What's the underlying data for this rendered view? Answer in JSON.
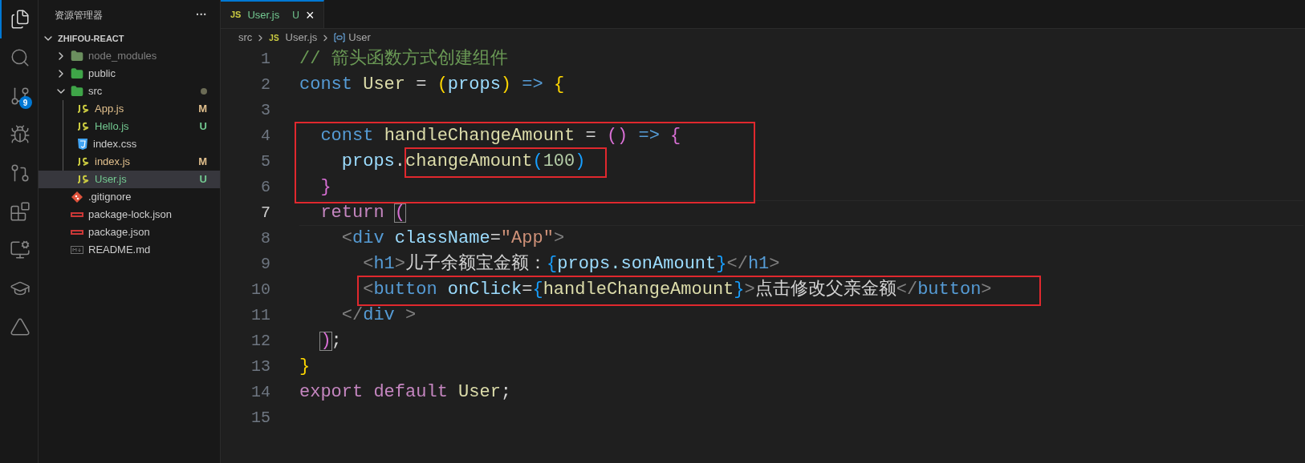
{
  "activity_bar": {
    "items": [
      {
        "kind": "explorer",
        "selected": true
      },
      {
        "kind": "search",
        "selected": false
      },
      {
        "kind": "source-control",
        "selected": false,
        "badge": "9"
      },
      {
        "kind": "run",
        "selected": false
      },
      {
        "kind": "git-graph",
        "selected": false
      },
      {
        "kind": "extensions",
        "selected": false
      },
      {
        "kind": "remote",
        "selected": false
      },
      {
        "kind": "learn",
        "selected": false
      },
      {
        "kind": "triangle",
        "selected": false
      }
    ]
  },
  "sidebar": {
    "title": "资源管理器",
    "more": "···",
    "project": {
      "name": "ZHIFOU-REACT",
      "expanded": true
    },
    "items": [
      {
        "name": "node_modules",
        "kind": "folder-node",
        "expanded": false,
        "dimmed": true,
        "selected": false
      },
      {
        "name": "public",
        "kind": "folder-public",
        "expanded": false,
        "dimmed": false,
        "selected": false
      },
      {
        "name": "src",
        "kind": "folder-src",
        "expanded": true,
        "dimmed": false,
        "selected": false,
        "dot": true,
        "children": [
          {
            "name": "App.js",
            "kind": "js",
            "status": "M",
            "color": "#e2c08d",
            "selected": false
          },
          {
            "name": "Hello.js",
            "kind": "js",
            "status": "U",
            "color": "#73c991",
            "selected": false
          },
          {
            "name": "index.css",
            "kind": "css",
            "selected": false
          },
          {
            "name": "index.js",
            "kind": "js",
            "status": "M",
            "color": "#e2c08d",
            "selected": false
          },
          {
            "name": "User.js",
            "kind": "js",
            "status": "U",
            "color": "#73c991",
            "selected": true
          }
        ]
      },
      {
        "name": ".gitignore",
        "kind": "git",
        "selected": false
      },
      {
        "name": "package-lock.json",
        "kind": "npm",
        "selected": false
      },
      {
        "name": "package.json",
        "kind": "npm",
        "selected": false
      },
      {
        "name": "README.md",
        "kind": "md",
        "selected": false
      }
    ]
  },
  "tabs": [
    {
      "icon_text": "JS",
      "label": "User.js",
      "status": "U",
      "close": "×",
      "selected": true
    }
  ],
  "breadcrumb": [
    {
      "kind": "folder",
      "text": "src"
    },
    {
      "kind": "file",
      "icon_text": "JS",
      "text": "User.js"
    },
    {
      "kind": "symbol",
      "text": "User"
    }
  ],
  "editor": {
    "lines": [
      {
        "number": "1",
        "current": false,
        "tokens": [
          {
            "text": "// 箭头函数方式创建组件",
            "kind": "comment"
          }
        ]
      },
      {
        "number": "2",
        "current": false,
        "tokens": [
          {
            "text": "const",
            "kind": "keyword"
          },
          {
            "text": " User",
            "kind": "function"
          },
          {
            "text": " = ",
            "kind": "plain"
          },
          {
            "text": "(",
            "kind": "bracket1"
          },
          {
            "text": "props",
            "kind": "variable"
          },
          {
            "text": ")",
            "kind": "bracket1"
          },
          {
            "text": " =>",
            "kind": "keyword"
          },
          {
            "text": " {",
            "kind": "bracket1"
          }
        ]
      },
      {
        "number": "3",
        "current": false
      },
      {
        "number": "4",
        "current": false,
        "tokens": [
          {
            "text": "  const",
            "kind": "keyword"
          },
          {
            "text": " handleChangeAmount",
            "kind": "function"
          },
          {
            "text": " = ",
            "kind": "plain"
          },
          {
            "text": "()",
            "kind": "bracket2"
          },
          {
            "text": " =>",
            "kind": "keyword"
          },
          {
            "text": " {",
            "kind": "bracket2"
          }
        ]
      },
      {
        "number": "5",
        "current": false,
        "tokens": [
          {
            "text": "    props",
            "kind": "variable"
          },
          {
            "text": ".",
            "kind": "plain"
          },
          {
            "text": "changeAmount",
            "kind": "function"
          },
          {
            "text": "(",
            "kind": "bracket3"
          },
          {
            "text": "100",
            "kind": "number"
          },
          {
            "text": ")",
            "kind": "bracket3"
          }
        ]
      },
      {
        "number": "6",
        "current": false,
        "tokens": [
          {
            "text": "  }",
            "kind": "bracket2"
          }
        ]
      },
      {
        "number": "7",
        "current": true,
        "tokens": [
          {
            "text": "  return",
            "kind": "control"
          },
          {
            "text": " (",
            "kind": "bracket2",
            "matched": true
          }
        ]
      },
      {
        "number": "8",
        "current": false,
        "tokens": [
          {
            "text": "    <",
            "kind": "angle"
          },
          {
            "text": "div",
            "kind": "tag"
          },
          {
            "text": " className",
            "kind": "variable"
          },
          {
            "text": "=",
            "kind": "plain"
          },
          {
            "text": "\"App\"",
            "kind": "string"
          },
          {
            "text": ">",
            "kind": "angle"
          }
        ]
      },
      {
        "number": "9",
        "current": false,
        "tokens": [
          {
            "text": "      <",
            "kind": "angle"
          },
          {
            "text": "h1",
            "kind": "tag"
          },
          {
            "text": ">",
            "kind": "angle"
          },
          {
            "text": "儿子余额宝金额：",
            "kind": "text"
          },
          {
            "text": "{",
            "kind": "bracket3"
          },
          {
            "text": "props.sonAmount",
            "kind": "variable"
          },
          {
            "text": "}",
            "kind": "bracket3"
          },
          {
            "text": "</",
            "kind": "angle"
          },
          {
            "text": "h1",
            "kind": "tag"
          },
          {
            "text": ">",
            "kind": "angle"
          }
        ]
      },
      {
        "number": "10",
        "current": false,
        "tokens": [
          {
            "text": "      <",
            "kind": "angle"
          },
          {
            "text": "button",
            "kind": "tag"
          },
          {
            "text": " onClick",
            "kind": "variable"
          },
          {
            "text": "=",
            "kind": "plain"
          },
          {
            "text": "{",
            "kind": "bracket3"
          },
          {
            "text": "handleChangeAmount",
            "kind": "function"
          },
          {
            "text": "}",
            "kind": "bracket3"
          },
          {
            "text": ">",
            "kind": "angle"
          },
          {
            "text": "点击修改父亲金额",
            "kind": "text"
          },
          {
            "text": "</",
            "kind": "angle"
          },
          {
            "text": "button",
            "kind": "tag"
          },
          {
            "text": ">",
            "kind": "angle"
          }
        ]
      },
      {
        "number": "11",
        "current": false,
        "tokens": [
          {
            "text": "    </",
            "kind": "angle"
          },
          {
            "text": "div",
            "kind": "tag"
          },
          {
            "text": " >",
            "kind": "angle"
          }
        ]
      },
      {
        "number": "12",
        "current": false,
        "tokens": [
          {
            "text": "  )",
            "kind": "bracket2",
            "matched": true
          },
          {
            "text": ";",
            "kind": "plain"
          }
        ]
      },
      {
        "number": "13",
        "current": false,
        "tokens": [
          {
            "text": "}",
            "kind": "bracket1"
          }
        ]
      },
      {
        "number": "14",
        "current": false,
        "tokens": [
          {
            "text": "export",
            "kind": "control"
          },
          {
            "text": " default",
            "kind": "control"
          },
          {
            "text": " User",
            "kind": "function"
          },
          {
            "text": ";",
            "kind": "plain"
          }
        ]
      },
      {
        "number": "15",
        "current": false
      }
    ]
  }
}
